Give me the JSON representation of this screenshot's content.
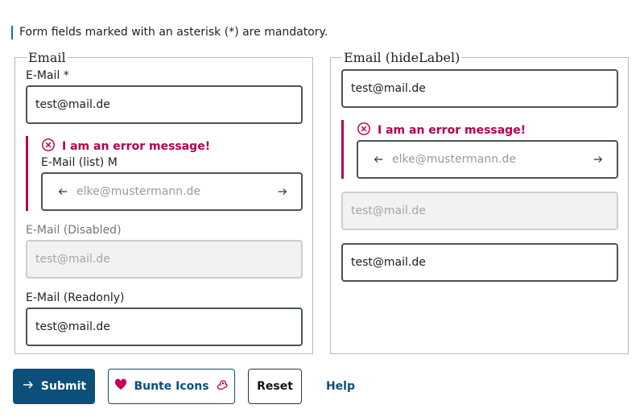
{
  "hint": "Form fields marked with an asterisk (*) are mandatory.",
  "left": {
    "legend": "Email",
    "email_label": "E-Mail *",
    "email_value": "test@mail.de",
    "error_message": "I am an error message!",
    "list_label": "E-Mail (list) M",
    "list_placeholder": "elke@mustermann.de",
    "disabled_label": "E-Mail (Disabled)",
    "disabled_value": "test@mail.de",
    "readonly_label": "E-Mail (Readonly)",
    "readonly_value": "test@mail.de"
  },
  "right": {
    "legend": "Email (hideLabel)",
    "email_value": "test@mail.de",
    "error_message": "I am an error message!",
    "list_placeholder": "elke@mustermann.de",
    "disabled_value": "test@mail.de",
    "readonly_value": "test@mail.de"
  },
  "buttons": {
    "submit": "Submit",
    "bunte": "Bunte Icons",
    "reset": "Reset",
    "help": "Help"
  },
  "colors": {
    "primary": "#0b4f7a",
    "error": "#b3004b",
    "heart": "#c8005a"
  },
  "icons": [
    "arrow-left-icon",
    "arrow-right-icon",
    "error-circle-icon",
    "heart-icon",
    "squirrel-icon"
  ]
}
